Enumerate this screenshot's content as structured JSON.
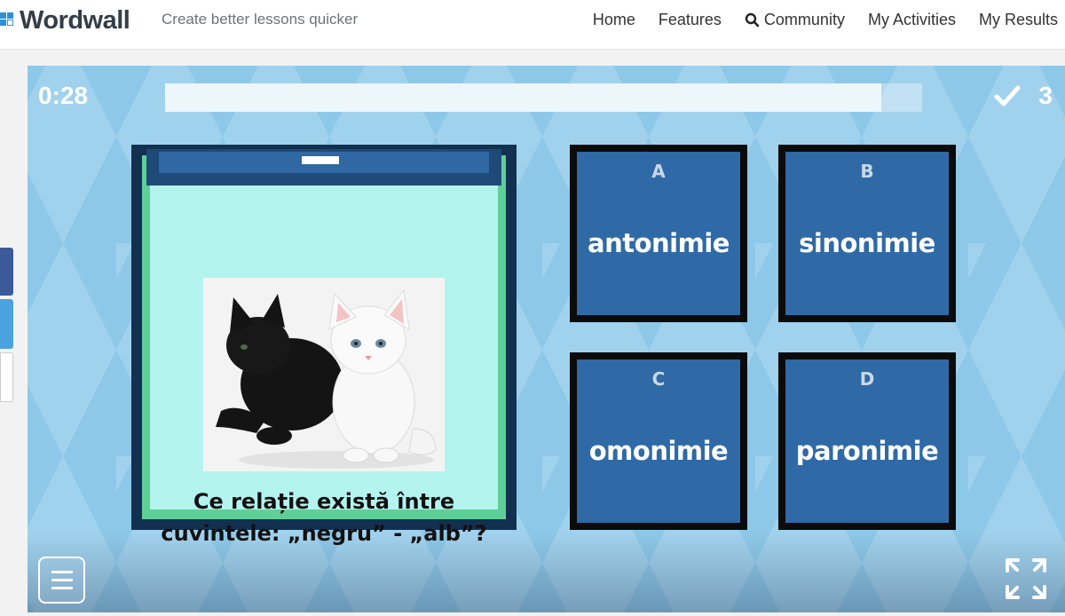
{
  "header": {
    "logo_text": "Wordwall",
    "tagline": "Create better lessons quicker",
    "nav": [
      {
        "label": "Home",
        "icon": null
      },
      {
        "label": "Features",
        "icon": null
      },
      {
        "label": "Community",
        "icon": "search-icon"
      },
      {
        "label": "My Activities",
        "icon": null
      },
      {
        "label": "My Results",
        "icon": null
      }
    ]
  },
  "game": {
    "timer": "0:28",
    "progress_fraction": 0.946,
    "score": "3",
    "question": {
      "text": "Ce relație există între cuvintele: „negru” - „alb”?",
      "image": "black-and-white-kittens"
    },
    "answers": [
      {
        "letter": "A",
        "label": "antonimie"
      },
      {
        "letter": "B",
        "label": "sinonimie"
      },
      {
        "letter": "C",
        "label": "omonimie"
      },
      {
        "letter": "D",
        "label": "paronimie"
      }
    ]
  },
  "colors": {
    "background": "#8ec8e8",
    "tile": "#2f6aa6",
    "card_face": "#b3f4ee",
    "card_border": "#5fcf98",
    "dark_frame": "#12304f"
  }
}
